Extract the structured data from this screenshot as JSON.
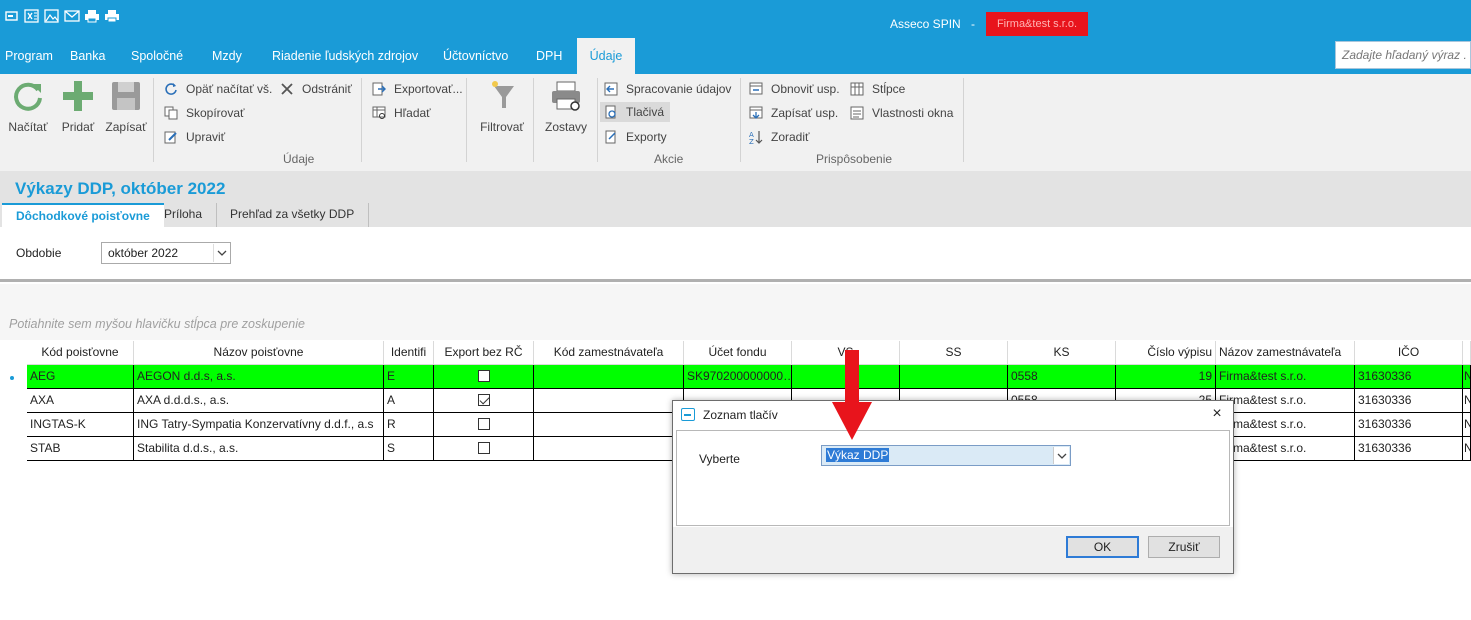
{
  "app": {
    "name": "Asseco SPIN",
    "separator": "-",
    "company": "Firma&test s.r.o."
  },
  "quick_access": [
    "window-icon",
    "excel-icon",
    "image-icon",
    "mail-icon",
    "print-icon",
    "print-preview-icon"
  ],
  "menu": {
    "items": [
      "Program",
      "Banka",
      "Spoločné",
      "Mzdy",
      "Riadenie ľudských zdrojov",
      "Účtovníctvo",
      "DPH",
      "Údaje"
    ],
    "active": "Údaje",
    "search_placeholder": "Zadajte hľadaný výraz . ."
  },
  "ribbon": {
    "udaje": {
      "nacitat": "Načítať",
      "pridat": "Pridať",
      "zapisat": "Zapísať",
      "opat_nacitat": "Opäť načítať vš.",
      "odstranit": "Odstrániť",
      "skopirovat": "Skopírovať",
      "upravit": "Upraviť",
      "label": "Údaje"
    },
    "export": {
      "exportovat": "Exportovať...",
      "hladat": "Hľadať"
    },
    "filter": {
      "filtrovat": "Filtrovať"
    },
    "akcie": {
      "zostavy": "Zostavy",
      "spracovanie": "Spracovanie údajov",
      "tlaciva": "Tlačivá",
      "exporty": "Exporty",
      "label": "Akcie"
    },
    "prisposobenie": {
      "obnovit": "Obnoviť usp.",
      "zapisat_usp": "Zapísať usp.",
      "zoradit": "Zoradiť",
      "stlpce": "Stĺpce",
      "vlastnosti": "Vlastnosti okna",
      "label": "Prispôsobenie"
    }
  },
  "page": {
    "title": "Výkazy DDP, október 2022",
    "tabs": [
      "Dôchodkové poisťovne",
      "Príloha",
      "Prehľad za všetky DDP"
    ],
    "active_tab": "Dôchodkové poisťovne",
    "period_label": "Obdobie",
    "period_value": "október 2022",
    "group_hint": "Potiahnite sem myšou hlavičku stĺpca pre zoskupenie"
  },
  "grid": {
    "columns": [
      "Kód poisťovne",
      "Názov poisťovne",
      "Identifi",
      "Export bez RČ",
      "Kód zamestnávateľa",
      "Účet fondu",
      "VS",
      "SS",
      "KS",
      "Číslo výpisu",
      "Názov zamestnávateľa",
      "IČO",
      "N"
    ],
    "rows": [
      {
        "kod": "AEG",
        "nazov": "AEGON d.d.s, a.s.",
        "ident": "E",
        "export": false,
        "kod_zam": "",
        "ucet": "SK970200000000…",
        "vs": "",
        "ss": "",
        "ks": "0558",
        "cislo": "19",
        "nazov_zam": "Firma&test s.r.o.",
        "ico": "31630336",
        "n": "N",
        "selected": true
      },
      {
        "kod": "AXA",
        "nazov": "AXA d.d.d.s., a.s.",
        "ident": "A",
        "export": true,
        "kod_zam": "",
        "ucet": "",
        "vs": "",
        "ss": "",
        "ks": "0558",
        "cislo": "25",
        "nazov_zam": "Firma&test s.r.o.",
        "ico": "31630336",
        "n": "N",
        "selected": false
      },
      {
        "kod": "INGTAS-K",
        "nazov": "ING Tatry-Sympatia Konzervatívny d.d.f., a.s",
        "ident": "R",
        "export": false,
        "kod_zam": "",
        "ucet": "",
        "vs": "",
        "ss": "",
        "ks": "",
        "cislo": "",
        "nazov_zam": "Firma&test s.r.o.",
        "ico": "31630336",
        "n": "N",
        "selected": false
      },
      {
        "kod": "STAB",
        "nazov": "Stabilita d.d.s., a.s.",
        "ident": "S",
        "export": false,
        "kod_zam": "",
        "ucet": "",
        "vs": "",
        "ss": "",
        "ks": "",
        "cislo": "",
        "nazov_zam": "Firma&test s.r.o.",
        "ico": "31630336",
        "n": "N",
        "selected": false
      }
    ]
  },
  "dialog": {
    "title": "Zoznam tlačív",
    "close": "×",
    "label": "Vyberte",
    "select_value": "Výkaz DDP",
    "ok": "OK",
    "cancel": "Zrušiť"
  },
  "colors": {
    "brand": "#1a9bd7",
    "selected_row": "#00ff00",
    "company_badge": "#e8141c",
    "annotation": "#d0142c"
  }
}
